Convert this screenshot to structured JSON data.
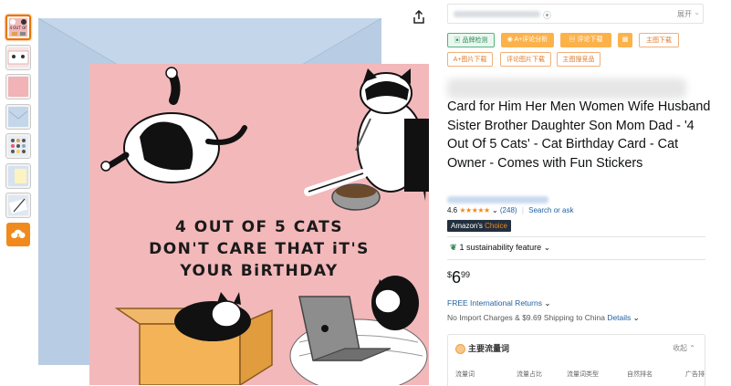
{
  "thumbnails": [
    {
      "name": "front",
      "color": "#f3b8ba",
      "active": true
    },
    {
      "name": "inside",
      "color": "#f6e4e4"
    },
    {
      "name": "back",
      "color": "#f1b3b5"
    },
    {
      "name": "envelope",
      "color": "#c4d6ea"
    },
    {
      "name": "stickers",
      "color": "#e9eef3"
    },
    {
      "name": "card-and-envelope",
      "color": "#d6e2ef"
    },
    {
      "name": "detail",
      "color": "#dfe8f1"
    },
    {
      "name": "download",
      "icon": "cloud-download-icon",
      "color": "#f08a1c"
    }
  ],
  "card": {
    "line1": "4 OUT OF 5 CATS",
    "line2": "DON'T CARE THAT iT'S",
    "line3": "YOUR BiRTHDAY",
    "background": "#f3b8ba",
    "envelope_color": "#b8cde3"
  },
  "location": {
    "expand_label": "展开"
  },
  "tools": {
    "row1": [
      "品牌检测",
      "A+评论分析",
      "评论下载",
      "",
      "主图下载"
    ],
    "row2": [
      "A+图片下载",
      "评论图片下载",
      "主图搜竞品"
    ]
  },
  "product": {
    "title": "Card for Him Her Men Women Wife Husband Sister Brother Daughter Son Mom Dad - '4 Out Of 5 Cats' - Cat Birthday Card - Cat Owner - Comes with Fun Stickers",
    "rating": "4.6",
    "stars": "★★★★★",
    "review_count": "(248)",
    "search_label": "Search or ask",
    "badge_prefix": "Amazon's",
    "badge_suffix": " Choice",
    "sustainability": "1 sustainability feature",
    "price_symbol": "$",
    "price_whole": "6",
    "price_fraction": "99",
    "returns": "FREE International Returns",
    "import_text": "No Import Charges & $9.69 Shipping to China",
    "details_link": "Details"
  },
  "traffic": {
    "title": "主要流量词",
    "collapse_label": "收起",
    "columns": [
      "流量词",
      "流量占比",
      "流量词类型",
      "自然排名",
      "广告排"
    ]
  },
  "colors": {
    "accent": "#f08a1c",
    "link": "#2162a1",
    "green": "#2f8c57",
    "badge_bg": "#232f3e"
  }
}
